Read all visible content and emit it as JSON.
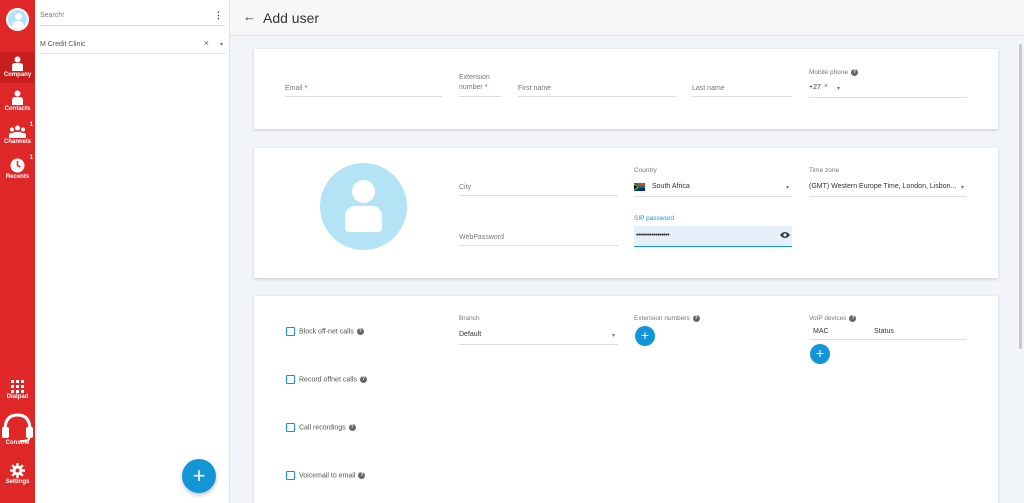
{
  "nav": {
    "company": "Company",
    "contacts": "Contacts",
    "channels": "Channels",
    "channels_badge": "1",
    "recents": "Recents",
    "recents_badge": "1",
    "dialpad": "Dialpad",
    "console": "Console",
    "settings": "Settings"
  },
  "list": {
    "search_placeholder": "Search!",
    "kebab": "⋮",
    "filter_value": "M Credit Clinic",
    "clear": "×",
    "dropdown": "▾",
    "add": "+"
  },
  "header": {
    "back": "←",
    "title": "Add user"
  },
  "basic": {
    "email_label": "Email",
    "required": "*",
    "extension_label_line1": "Extension",
    "extension_label_line2": "number",
    "first_name": "First name",
    "last_name": "Last name",
    "mobile_label": "Mobile phone",
    "help": "?",
    "country_code": "+27",
    "clear": "×",
    "dropdown": "▾"
  },
  "profile": {
    "city": "City",
    "country_label": "Country",
    "country_value": "South Africa",
    "timezone_label": "Time zone",
    "timezone_value": "(GMT) Western Europe Time, London, Lisbon...",
    "web_password": "WebPassword",
    "sip_label": "SIP password",
    "sip_value": "•••••••••••••••••",
    "dropdown": "▾"
  },
  "settings": {
    "block_offnet": "Block off-net calls",
    "record_offnet": "Record offnet calls",
    "call_recordings": "Call recordings",
    "voicemail_email": "Voicemail to email",
    "branch_label": "Branch",
    "branch_value": "Default",
    "extension_numbers": "Extension numbers",
    "voip_devices": "VoIP devices",
    "col_mac": "MAC",
    "col_status": "Status",
    "help": "?",
    "add": "+",
    "dropdown": "▾"
  },
  "colors": {
    "rail": "#e02727",
    "accent": "#1396d8",
    "avatar": "#b3e3f5"
  }
}
